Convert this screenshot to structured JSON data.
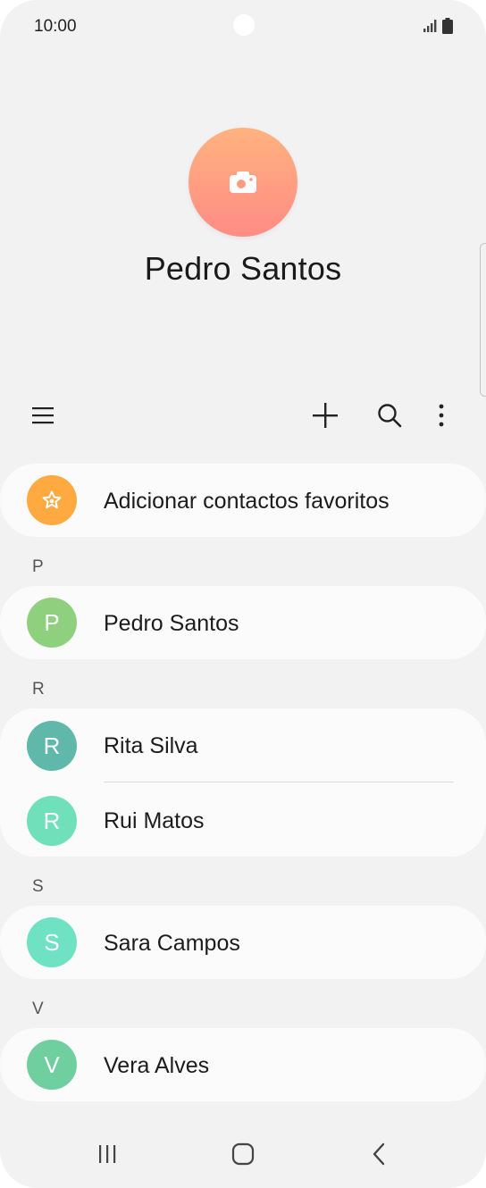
{
  "status_bar": {
    "time": "10:00"
  },
  "profile": {
    "name": "Pedro Santos"
  },
  "toolbar": {
    "menu_icon": "menu-icon",
    "add_icon": "plus-icon",
    "search_icon": "search-icon",
    "more_icon": "more-vertical-icon"
  },
  "favorites": {
    "label": "Adicionar contactos favoritos",
    "icon": "star-icon",
    "color": "#ffaa40"
  },
  "sections": [
    {
      "letter": "P",
      "contacts": [
        {
          "initial": "P",
          "name": "Pedro Santos",
          "color": "#8fd07e"
        }
      ]
    },
    {
      "letter": "R",
      "contacts": [
        {
          "initial": "R",
          "name": "Rita Silva",
          "color": "#5fb8aa"
        },
        {
          "initial": "R",
          "name": "Rui Matos",
          "color": "#6fe0ba"
        }
      ]
    },
    {
      "letter": "S",
      "contacts": [
        {
          "initial": "S",
          "name": "Sara Campos",
          "color": "#6ee2c2"
        }
      ]
    },
    {
      "letter": "V",
      "contacts": [
        {
          "initial": "V",
          "name": "Vera Alves",
          "color": "#6fcf9e"
        }
      ]
    }
  ],
  "nav": {
    "recents_icon": "recents-icon",
    "home_icon": "home-icon",
    "back_icon": "back-icon"
  }
}
